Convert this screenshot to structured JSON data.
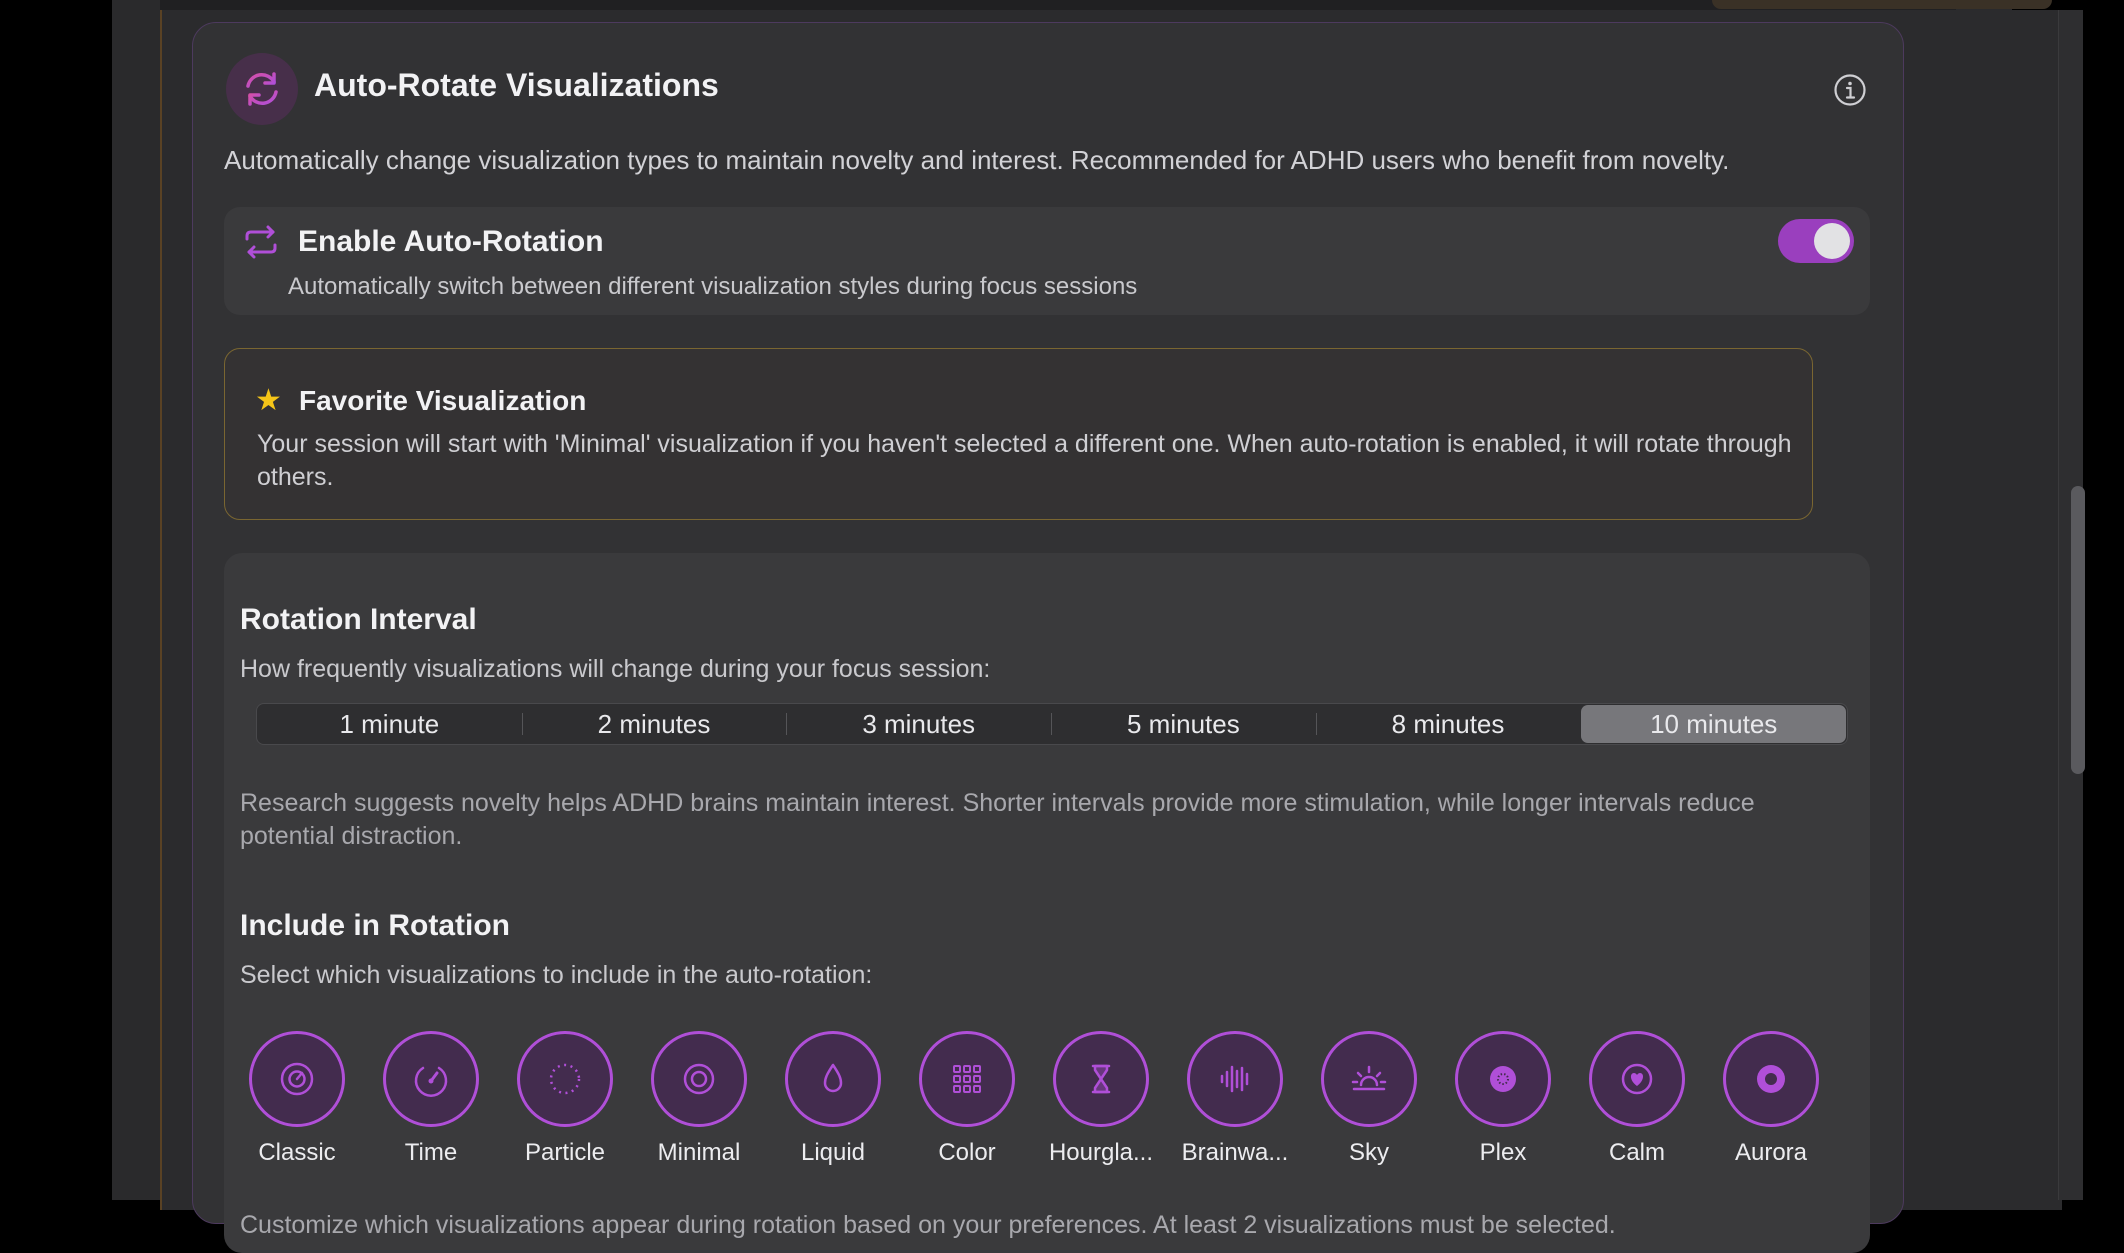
{
  "card": {
    "title": "Auto-Rotate Visualizations",
    "description": "Automatically change visualization types to maintain novelty and interest. Recommended for ADHD users who benefit from novelty.",
    "header_icon": "rotate-arrows-icon",
    "info_icon": "info-icon"
  },
  "toggle": {
    "title": "Enable Auto-Rotation",
    "subtitle": "Automatically switch between different visualization styles during focus sessions",
    "icon": "repeat-arrows-icon",
    "enabled": true
  },
  "favorite": {
    "title": "Favorite Visualization",
    "text": "Your session will start with 'Minimal' visualization if you haven't selected a different one. When auto-rotation is enabled, it will rotate through others."
  },
  "interval": {
    "title": "Rotation Interval",
    "subtitle": "How frequently visualizations will change during your focus session:",
    "options": [
      "1 minute",
      "2 minutes",
      "3 minutes",
      "5 minutes",
      "8 minutes",
      "10 minutes"
    ],
    "selected": "10 minutes",
    "research": "Research suggests novelty helps ADHD brains maintain interest. Shorter intervals provide more stimulation, while longer intervals reduce potential distraction."
  },
  "include": {
    "title": "Include in Rotation",
    "subtitle": "Select which visualizations to include in the auto-rotation:",
    "items": [
      {
        "label": "Classic",
        "icon": "timer-circle-icon"
      },
      {
        "label": "Time",
        "icon": "gauge-icon"
      },
      {
        "label": "Particle",
        "icon": "dotted-circle-icon"
      },
      {
        "label": "Minimal",
        "icon": "target-ring-icon"
      },
      {
        "label": "Liquid",
        "icon": "droplet-icon"
      },
      {
        "label": "Color",
        "icon": "grid-icon"
      },
      {
        "label": "Hourgla...",
        "icon": "hourglass-icon"
      },
      {
        "label": "Brainwa...",
        "icon": "waveform-icon"
      },
      {
        "label": "Sky",
        "icon": "sunrise-icon"
      },
      {
        "label": "Plex",
        "icon": "filled-dot-icon"
      },
      {
        "label": "Calm",
        "icon": "heart-circle-icon"
      },
      {
        "label": "Aurora",
        "icon": "record-icon"
      }
    ],
    "footer": "Customize which visualizations appear during rotation based on your preferences. At least 2 visualizations must be selected."
  },
  "colors": {
    "accent": "#b04fd8",
    "toggle_on": "#9a3fbe",
    "favorite_border": "#7a6631",
    "star": "#f5c518"
  }
}
